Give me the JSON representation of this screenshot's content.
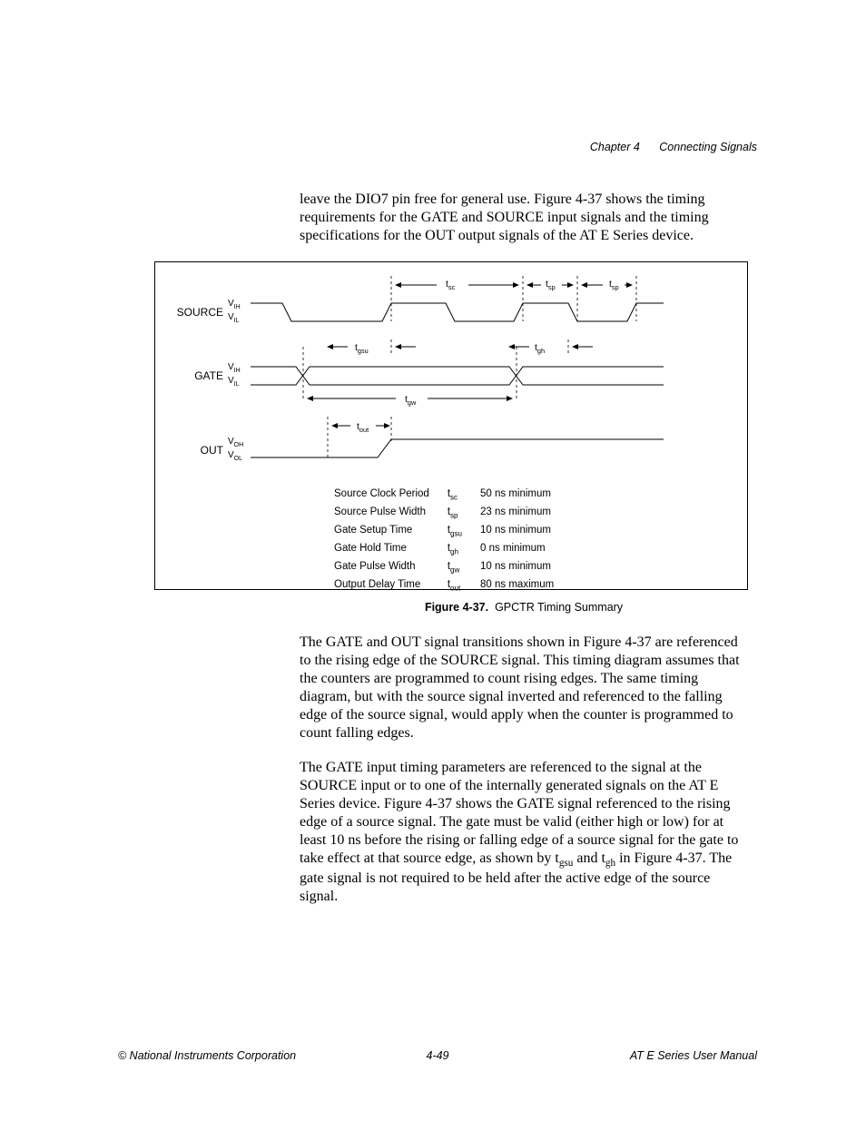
{
  "header": {
    "chapter": "Chapter 4",
    "title": "Connecting Signals"
  },
  "intro": "leave the DIO7 pin free for general use. Figure 4-37 shows the timing requirements for the GATE and SOURCE input signals and the timing specifications for the OUT output signals of the AT E Series device.",
  "signals": {
    "source": {
      "name": "SOURCE",
      "hi": "V",
      "hi_sub": "IH",
      "lo": "V",
      "lo_sub": "IL"
    },
    "gate": {
      "name": "GATE",
      "hi": "V",
      "hi_sub": "IH",
      "lo": "V",
      "lo_sub": "IL"
    },
    "out": {
      "name": "OUT",
      "hi": "V",
      "hi_sub": "OH",
      "lo": "V",
      "lo_sub": "OL"
    }
  },
  "timing_labels": {
    "tsc": {
      "sym": "t",
      "sub": "sc"
    },
    "tsp": {
      "sym": "t",
      "sub": "sp"
    },
    "tgsu": {
      "sym": "t",
      "sub": "gsu"
    },
    "tgh": {
      "sym": "t",
      "sub": "gh"
    },
    "tgw": {
      "sym": "t",
      "sub": "gw"
    },
    "tout": {
      "sym": "t",
      "sub": "out"
    }
  },
  "specs": [
    {
      "name": "Source Clock Period",
      "sym": "t",
      "sub": "sc",
      "val": "50 ns minimum"
    },
    {
      "name": "Source Pulse Width",
      "sym": "t",
      "sub": "sp",
      "val": "23 ns minimum"
    },
    {
      "name": "Gate Setup Time",
      "sym": "t",
      "sub": "gsu",
      "val": "10 ns minimum"
    },
    {
      "name": "Gate Hold Time",
      "sym": "t",
      "sub": "gh",
      "val": "0 ns minimum"
    },
    {
      "name": "Gate Pulse Width",
      "sym": "t",
      "sub": "gw",
      "val": "10 ns minimum"
    },
    {
      "name": "Output Delay Time",
      "sym": "t",
      "sub": "out",
      "val": "80 ns maximum"
    }
  ],
  "caption": {
    "fig": "Figure 4-37.",
    "text": "GPCTR Timing Summary"
  },
  "para1_a": "The GATE and OUT signal transitions shown in Figure 4-37 are referenced to the rising edge of the SOURCE signal. This timing diagram assumes that the counters are programmed to count rising edges. The same timing diagram, but with the source signal inverted and referenced to the falling edge of the source signal, would apply when the counter is programmed to count falling edges.",
  "para2_a": "The GATE input timing parameters are referenced to the signal at the SOURCE input or to one of the internally generated signals on the AT E Series device. Figure 4-37 shows the GATE signal referenced to the rising edge of a source signal. The gate must be valid (either high or low) for at least 10 ns before the rising or falling edge of a source signal for the gate to take effect at that source edge, as shown by t",
  "para2_sub1": "gsu",
  "para2_b": " and t",
  "para2_sub2": "gh",
  "para2_c": " in Figure 4-37. The gate signal is not required to be held after the active edge of the source signal.",
  "footer": {
    "left": "© National Instruments Corporation",
    "center": "4-49",
    "right": "AT E Series User Manual"
  }
}
